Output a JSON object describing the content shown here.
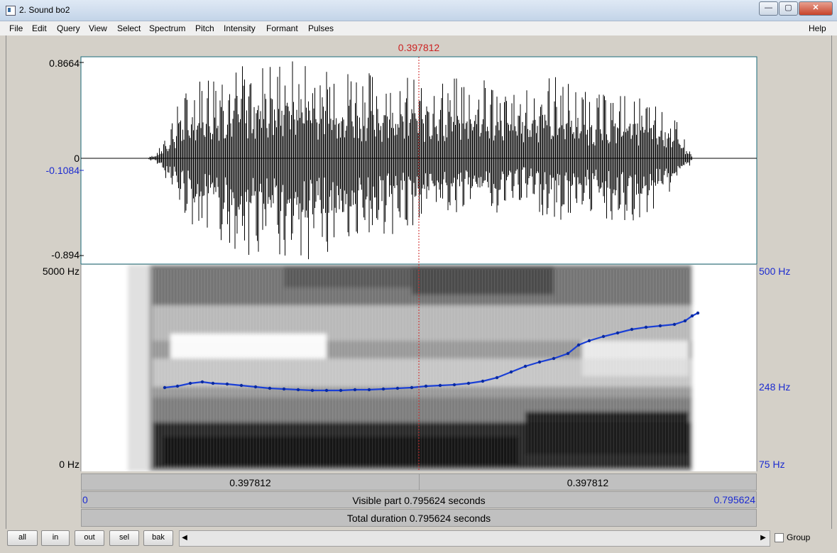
{
  "window": {
    "title": "2. Sound bo2",
    "controls": {
      "minimize": "—",
      "maximize": "▢",
      "close": "✕"
    }
  },
  "menu": {
    "items": [
      "File",
      "Edit",
      "Query",
      "View",
      "Select",
      "Spectrum",
      "Pitch",
      "Intensity",
      "Formant",
      "Pulses"
    ],
    "help": "Help"
  },
  "cursor": {
    "time_label": "0.397812"
  },
  "waveform": {
    "max_label": "0.8664",
    "zero_label": "0",
    "cursor_value": "-0.1084",
    "min_label": "-0.894"
  },
  "spectrogram": {
    "freq_top": "5000 Hz",
    "freq_bottom": "0 Hz"
  },
  "pitch": {
    "top": "500 Hz",
    "mid": "248 Hz",
    "bottom": "75 Hz"
  },
  "time_bar": {
    "left_segment": "0.397812",
    "right_segment": "0.397812"
  },
  "visible_bar": {
    "start": "0",
    "text": "Visible part 0.795624 seconds",
    "end": "0.795624"
  },
  "total_bar": {
    "text": "Total duration 0.795624 seconds"
  },
  "bottom_buttons": {
    "all": "all",
    "in": "in",
    "out": "out",
    "sel": "sel",
    "bak": "bak"
  },
  "group": {
    "label": "Group",
    "checked": false
  },
  "colors": {
    "pitch_line": "#1a3fd6",
    "cursor": "#cc2222",
    "label_blue": "#1c2bd0"
  }
}
